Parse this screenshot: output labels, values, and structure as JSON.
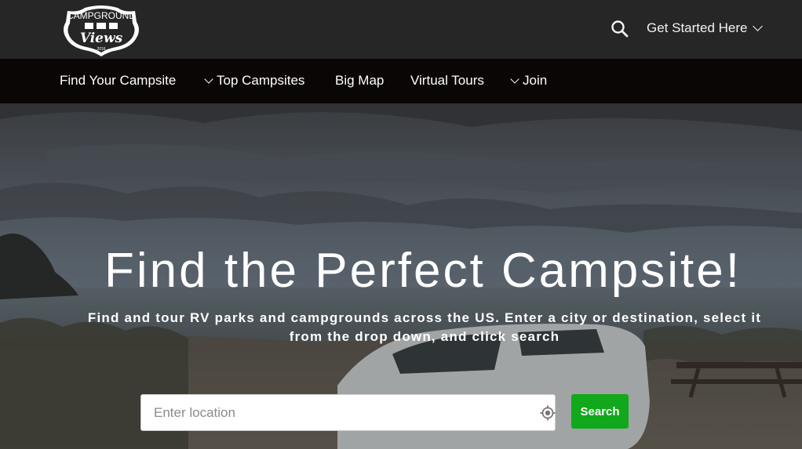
{
  "header": {
    "logo": {
      "line1": "CAMPGROUND",
      "line2": "Views",
      "line3": "2016",
      "icon": "logo-shield"
    },
    "search_icon": "search-icon",
    "get_started_label": "Get Started Here"
  },
  "nav": {
    "items": [
      {
        "label": "Find Your Campsite",
        "has_dropdown": false
      },
      {
        "label": "Top Campsites",
        "has_dropdown": true
      },
      {
        "label": "Big Map",
        "has_dropdown": false
      },
      {
        "label": "Virtual Tours",
        "has_dropdown": false
      },
      {
        "label": "Join",
        "has_dropdown": true
      }
    ]
  },
  "hero": {
    "title": "Find the Perfect Campsite!",
    "subtitle_line1": "Find and tour RV parks and campgrounds across the US. Enter a city or destination, select it",
    "subtitle_line2": "from the drop down, and click search",
    "search_placeholder": "Enter location",
    "search_value": "",
    "locate_icon": "crosshair-icon",
    "search_button_label": "Search"
  },
  "colors": {
    "topbar": "#262626",
    "navbar": "#0b0606",
    "search_button": "#11a81b",
    "text": "#ffffff"
  }
}
